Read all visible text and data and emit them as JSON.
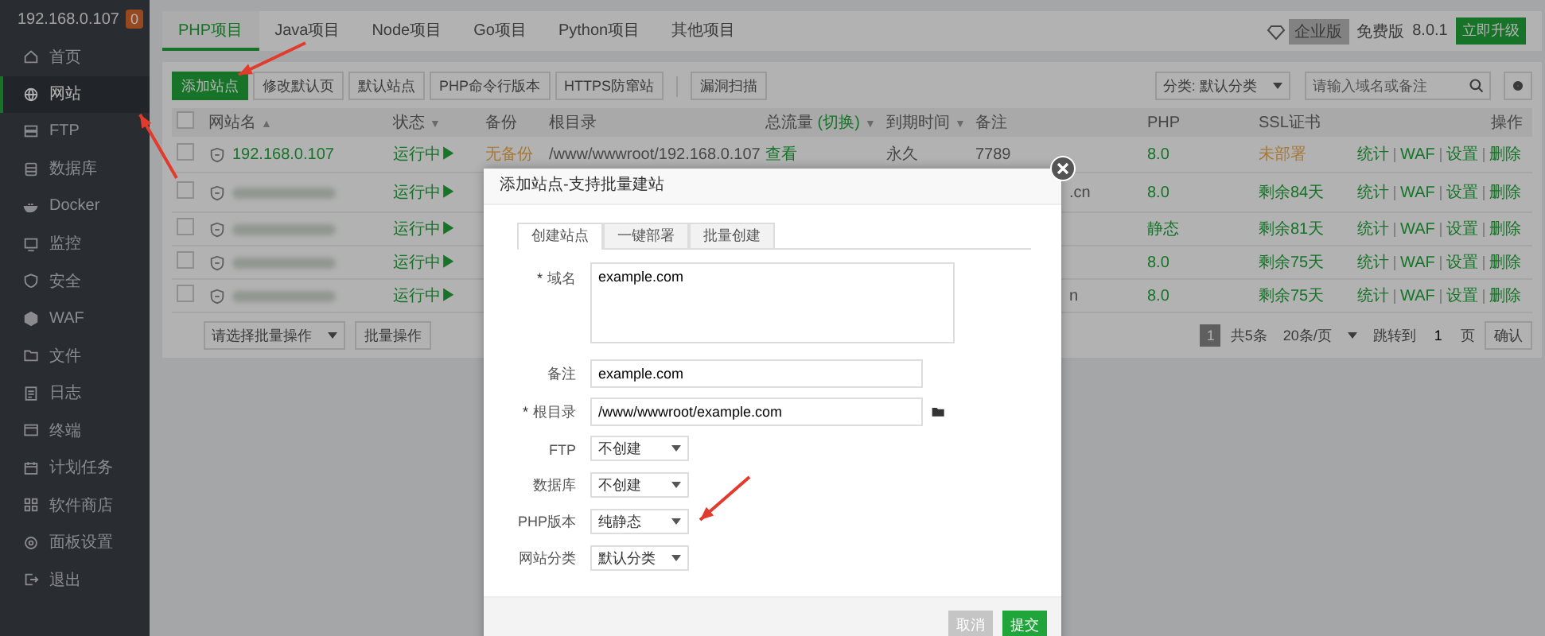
{
  "sidebar": {
    "server": "192.168.0.107",
    "badge": "0",
    "items": [
      {
        "label": "首页",
        "selected": false
      },
      {
        "label": "网站",
        "selected": true
      },
      {
        "label": "FTP",
        "selected": false
      },
      {
        "label": "数据库",
        "selected": false
      },
      {
        "label": "Docker",
        "selected": false
      },
      {
        "label": "监控",
        "selected": false
      },
      {
        "label": "安全",
        "selected": false
      },
      {
        "label": "WAF",
        "selected": false
      },
      {
        "label": "文件",
        "selected": false
      },
      {
        "label": "日志",
        "selected": false
      },
      {
        "label": "终端",
        "selected": false
      },
      {
        "label": "计划任务",
        "selected": false
      },
      {
        "label": "软件商店",
        "selected": false
      },
      {
        "label": "面板设置",
        "selected": false
      },
      {
        "label": "退出",
        "selected": false
      }
    ]
  },
  "topbar": {
    "tabs": [
      {
        "label": "PHP项目",
        "selected": true
      },
      {
        "label": "Java项目",
        "selected": false
      },
      {
        "label": "Node项目",
        "selected": false
      },
      {
        "label": "Go项目",
        "selected": false
      },
      {
        "label": "Python项目",
        "selected": false
      },
      {
        "label": "其他项目",
        "selected": false
      }
    ],
    "edition_badge": "企业版",
    "edition": "免费版",
    "version": "8.0.1",
    "upgrade_button": "立即升级"
  },
  "toolbar": {
    "buttons": [
      {
        "label": "添加站点",
        "kind": "primary"
      },
      {
        "label": "修改默认页",
        "kind": "default"
      },
      {
        "label": "默认站点",
        "kind": "default"
      },
      {
        "label": "PHP命令行版本",
        "kind": "default"
      },
      {
        "label": "HTTPS防窜站",
        "kind": "default"
      },
      {
        "label": "漏洞扫描",
        "kind": "separated"
      }
    ],
    "category": "分类: 默认分类",
    "search": {
      "placeholder": "请输入域名或备注"
    }
  },
  "table": {
    "header_checked": false,
    "columns": [
      {
        "label": "网站名",
        "sort": "▲"
      },
      {
        "label": "状态",
        "sort": "▼"
      },
      {
        "label": "备份"
      },
      {
        "label": "根目录"
      },
      {
        "label": "总流量",
        "extra": "(切换)",
        "sort": "▼"
      },
      {
        "label": "到期时间",
        "sort": "▼"
      },
      {
        "label": "备注"
      },
      {
        "label": "PHP"
      },
      {
        "label": "SSL证书"
      },
      {
        "label": "操作"
      }
    ],
    "rows": [
      {
        "checked": false,
        "name": "192.168.0.107",
        "status": "运行中▶",
        "backup": "无备份",
        "root": "/www/wwwroot/192.168.0.107",
        "traffic": "查看",
        "expiry": "永久",
        "note": "7789",
        "php": "8.0",
        "ssl": "未部署",
        "ssl_ok": false,
        "actions": [
          "统计",
          "WAF",
          "设置",
          "删除"
        ]
      },
      {
        "checked": false,
        "status": "运行中▶",
        "note": ".cn",
        "php": "8.0",
        "ssl": "剩余84天",
        "ssl_ok": true,
        "actions": [
          "统计",
          "WAF",
          "设置",
          "删除"
        ]
      },
      {
        "checked": false,
        "status": "运行中▶",
        "php": "静态",
        "ssl": "剩余81天",
        "ssl_ok": true,
        "actions": [
          "统计",
          "WAF",
          "设置",
          "删除"
        ]
      },
      {
        "checked": false,
        "status": "运行中▶",
        "php": "8.0",
        "ssl": "剩余75天",
        "ssl_ok": true,
        "actions": [
          "统计",
          "WAF",
          "设置",
          "删除"
        ]
      },
      {
        "checked": false,
        "status": "运行中▶",
        "note": "n",
        "php": "8.0",
        "ssl": "剩余75天",
        "ssl_ok": true,
        "actions": [
          "统计",
          "WAF",
          "设置",
          "删除"
        ]
      }
    ]
  },
  "footer": {
    "batch_select": "请选择批量操作",
    "batch_button": "批量操作",
    "page": "1",
    "total": "共5条",
    "page_size": "20条/页",
    "jump_label": "跳转到",
    "jump_value": "1",
    "page_unit": "页",
    "confirm": "确认"
  },
  "dialog": {
    "title": "添加站点-支持批量建站",
    "tabs": [
      {
        "label": "创建站点",
        "selected": true
      },
      {
        "label": "一键部署",
        "selected": false
      },
      {
        "label": "批量创建",
        "selected": false
      }
    ],
    "fields": [
      {
        "label": "域名",
        "marker": "*",
        "kind": "textarea",
        "value": "example.com"
      },
      {
        "label": "备注",
        "kind": "input",
        "value": "example.com"
      },
      {
        "label": "根目录",
        "marker": "*",
        "kind": "path",
        "value": "/www/wwwroot/example.com"
      },
      {
        "label": "FTP",
        "kind": "select",
        "value": "不创建"
      },
      {
        "label": "数据库",
        "kind": "select",
        "value": "不创建"
      },
      {
        "label": "PHP版本",
        "kind": "select",
        "value": "纯静态"
      },
      {
        "label": "网站分类",
        "kind": "select",
        "value": "默认分类"
      }
    ],
    "buttons": [
      {
        "label": "取消",
        "kind": "cancel"
      },
      {
        "label": "提交",
        "kind": "submit"
      }
    ]
  }
}
